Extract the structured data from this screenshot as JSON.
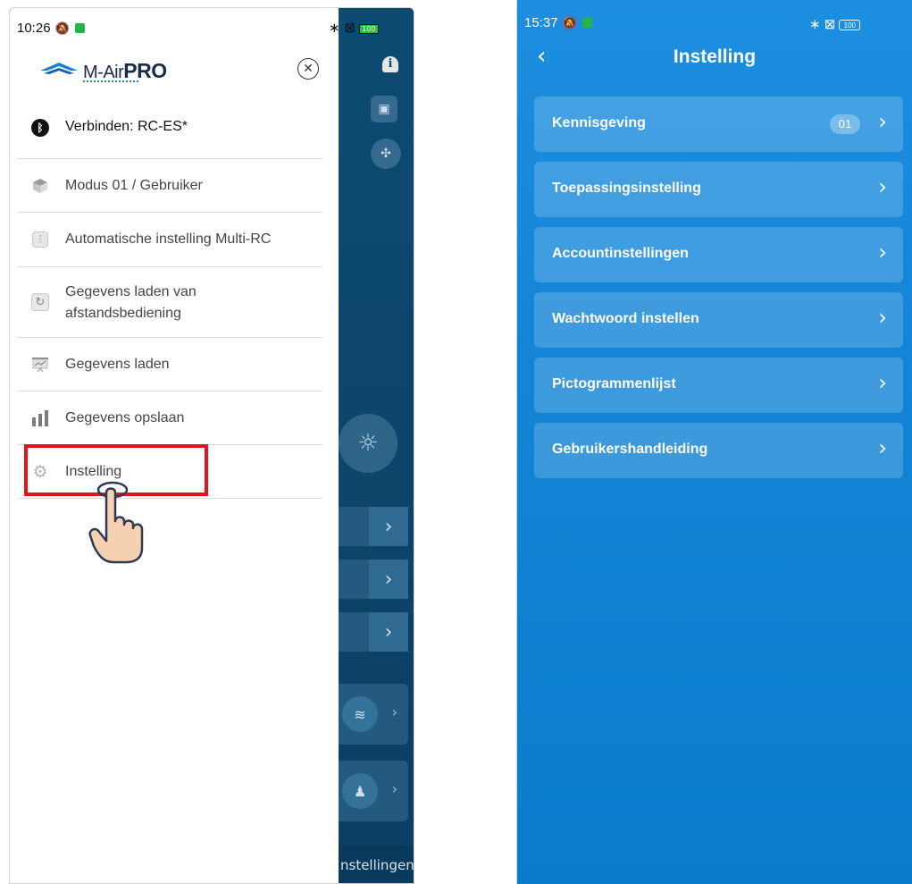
{
  "left_screen": {
    "status_bar": {
      "time": "10:26",
      "battery": "100"
    },
    "drawer": {
      "logo_text": "M-Air",
      "logo_text_bold": "PRO",
      "menu": [
        {
          "label": "Verbinden: RC-ES*",
          "icon": "bluetooth-icon"
        },
        {
          "label": "Modus 01 / Gebruiker",
          "icon": "cube-icon"
        },
        {
          "label": "Automatische instelling Multi-RC",
          "icon": "sliders-icon"
        },
        {
          "label": "Gegevens laden van afstandsbediening",
          "icon": "sync-icon"
        },
        {
          "label": "Gegevens laden",
          "icon": "presentation-board-icon"
        },
        {
          "label": "Gegevens opslaan",
          "icon": "bar-chart-icon"
        },
        {
          "label": "Instelling",
          "icon": "gear-icon"
        }
      ]
    },
    "background": {
      "bottom_nav_label": "nstellingen"
    }
  },
  "right_screen": {
    "status_bar": {
      "time": "15:37",
      "battery": "100"
    },
    "header": {
      "title": "Instelling"
    },
    "settings": [
      {
        "label": "Kennisgeving",
        "badge": "01"
      },
      {
        "label": "Toepassingsinstelling"
      },
      {
        "label": "Accountinstellingen"
      },
      {
        "label": "Wachtwoord instellen"
      },
      {
        "label": "Pictogrammenlijst"
      },
      {
        "label": "Gebruikershandleiding"
      }
    ]
  },
  "colors": {
    "highlight_box": "#e3131b",
    "right_background": "#1485d6",
    "left_background": "#0c4a73",
    "logo_accent": "#1d7fce"
  }
}
